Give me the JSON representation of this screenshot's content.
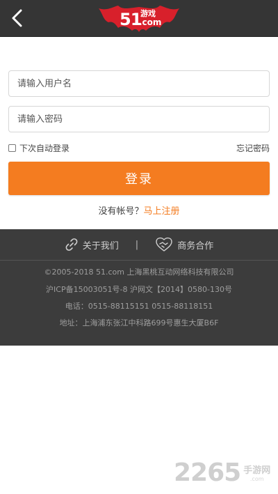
{
  "header": {
    "back_icon": "chevron-left-icon",
    "logo": {
      "number": "51",
      "game": "游戏",
      "domain": ".com"
    }
  },
  "form": {
    "username_placeholder": "请输入用户名",
    "password_placeholder": "请输入密码",
    "remember_label": "下次自动登录",
    "forgot_label": "忘记密码",
    "login_label": "登录",
    "no_account_text": "没有帐号？",
    "register_label": "马上注册"
  },
  "footer": {
    "about_label": "关于我们",
    "separator": "|",
    "business_label": "商务合作",
    "copyright": "©2005-2018 51.com 上海黑桃互动网络科技有限公司",
    "icp": "沪ICP备15003051号-8 沪网文【2014】0580-130号",
    "phone": "电话：0515-88115151 0515-88118151",
    "address": "地址：上海浦东张江中科路699号惠生大厦B6F"
  },
  "watermark": {
    "number": "2265",
    "cn": "手游网",
    "url": ".com"
  },
  "colors": {
    "header_bg": "#353535",
    "accent": "#f47c20",
    "logo_red": "#d8202b",
    "footer_bg": "#3c3c3c"
  }
}
